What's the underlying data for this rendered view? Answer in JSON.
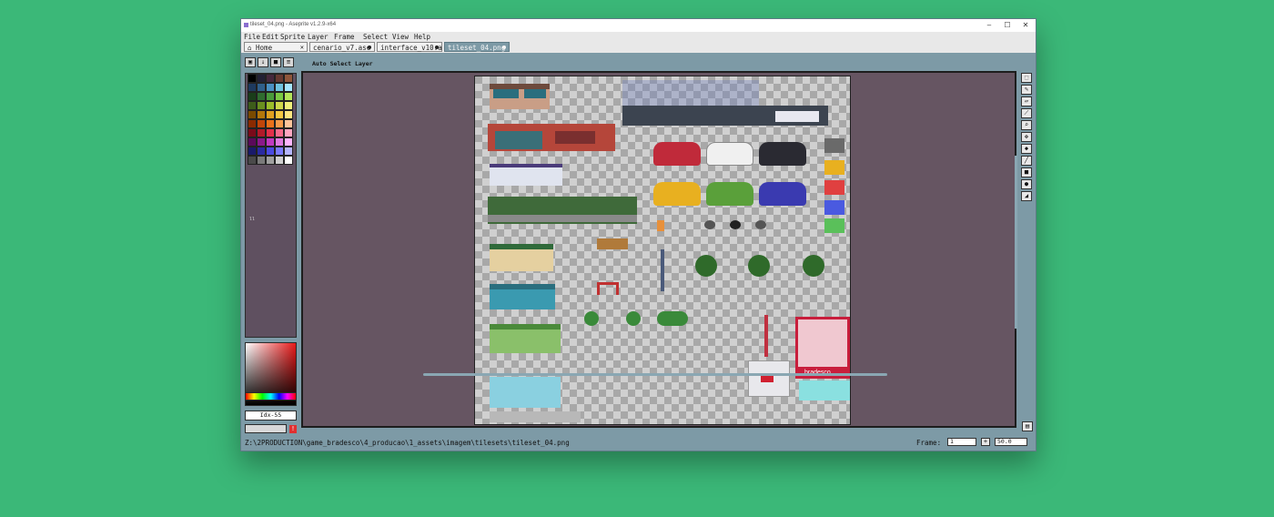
{
  "window": {
    "title": "tileset_04.png - Aseprite v1.2.9-x64",
    "controls": {
      "minimize": "–",
      "maximize": "☐",
      "close": "✕"
    }
  },
  "menu": [
    "File",
    "Edit",
    "Sprite",
    "Layer",
    "Frame",
    "Select",
    "View",
    "Help"
  ],
  "tabs": [
    {
      "label": "Home",
      "icon": "home-icon",
      "close": "✕",
      "active": false
    },
    {
      "label": "cenario_v7.ase",
      "modified": true,
      "active": false
    },
    {
      "label": "interface_v10.a",
      "modified": true,
      "active": false
    },
    {
      "label": "tileset_04.png",
      "modified": false,
      "active": true
    }
  ],
  "context_bar": {
    "option_label": "Auto Select Layer"
  },
  "palette": {
    "colors": [
      "#000000",
      "#222034",
      "#45283c",
      "#663931",
      "#8f563b",
      "#1e3a5f",
      "#2f5f8a",
      "#4a90c2",
      "#6fc3df",
      "#a6e6ff",
      "#1a3d1a",
      "#2f6b2f",
      "#4a9a3a",
      "#7ac943",
      "#b5e55a",
      "#3d5c1a",
      "#6a8f1f",
      "#9bbd2a",
      "#cfd84a",
      "#f0f07a",
      "#7a4a00",
      "#b3760a",
      "#e0a020",
      "#f5c842",
      "#ffe680",
      "#8a2a00",
      "#c0450a",
      "#e8701a",
      "#f59a4a",
      "#ffc49a",
      "#7a0a1a",
      "#b01a2a",
      "#e0304a",
      "#f56a8a",
      "#ffa6c0",
      "#5a0a5a",
      "#8a1a8a",
      "#c03ac0",
      "#e07ae0",
      "#ffb5ff",
      "#1a1a6a",
      "#2a2aa0",
      "#4a4ae0",
      "#7a7aff",
      "#b5b5ff",
      "#4a4a4a",
      "#7a7a7a",
      "#a0a0a0",
      "#d0d0d0",
      "#ffffff"
    ],
    "index_label": "Idx-55"
  },
  "status": {
    "path": "Z:\\2PRODUCTION\\game_bradesco\\4_producao\\1_assets\\imagem\\tilesets\\tileset_04.png",
    "frame_label": "Frame:",
    "frame_value": "1",
    "frame_add": "+",
    "zoom": "50.0"
  },
  "canvas": {
    "sign_text": "bradesco",
    "tileset_icons": [
      "building-tile",
      "car-red",
      "car-white",
      "car-black",
      "car-yellow",
      "car-green",
      "car-blue",
      "tree",
      "lamp-post",
      "bench",
      "bus-stop",
      "bank-building"
    ]
  },
  "tools": [
    "marquee",
    "pencil",
    "eraser",
    "eyedropper",
    "zoom",
    "move",
    "paint-bucket",
    "line",
    "rectangle",
    "ellipse",
    "contour"
  ]
}
